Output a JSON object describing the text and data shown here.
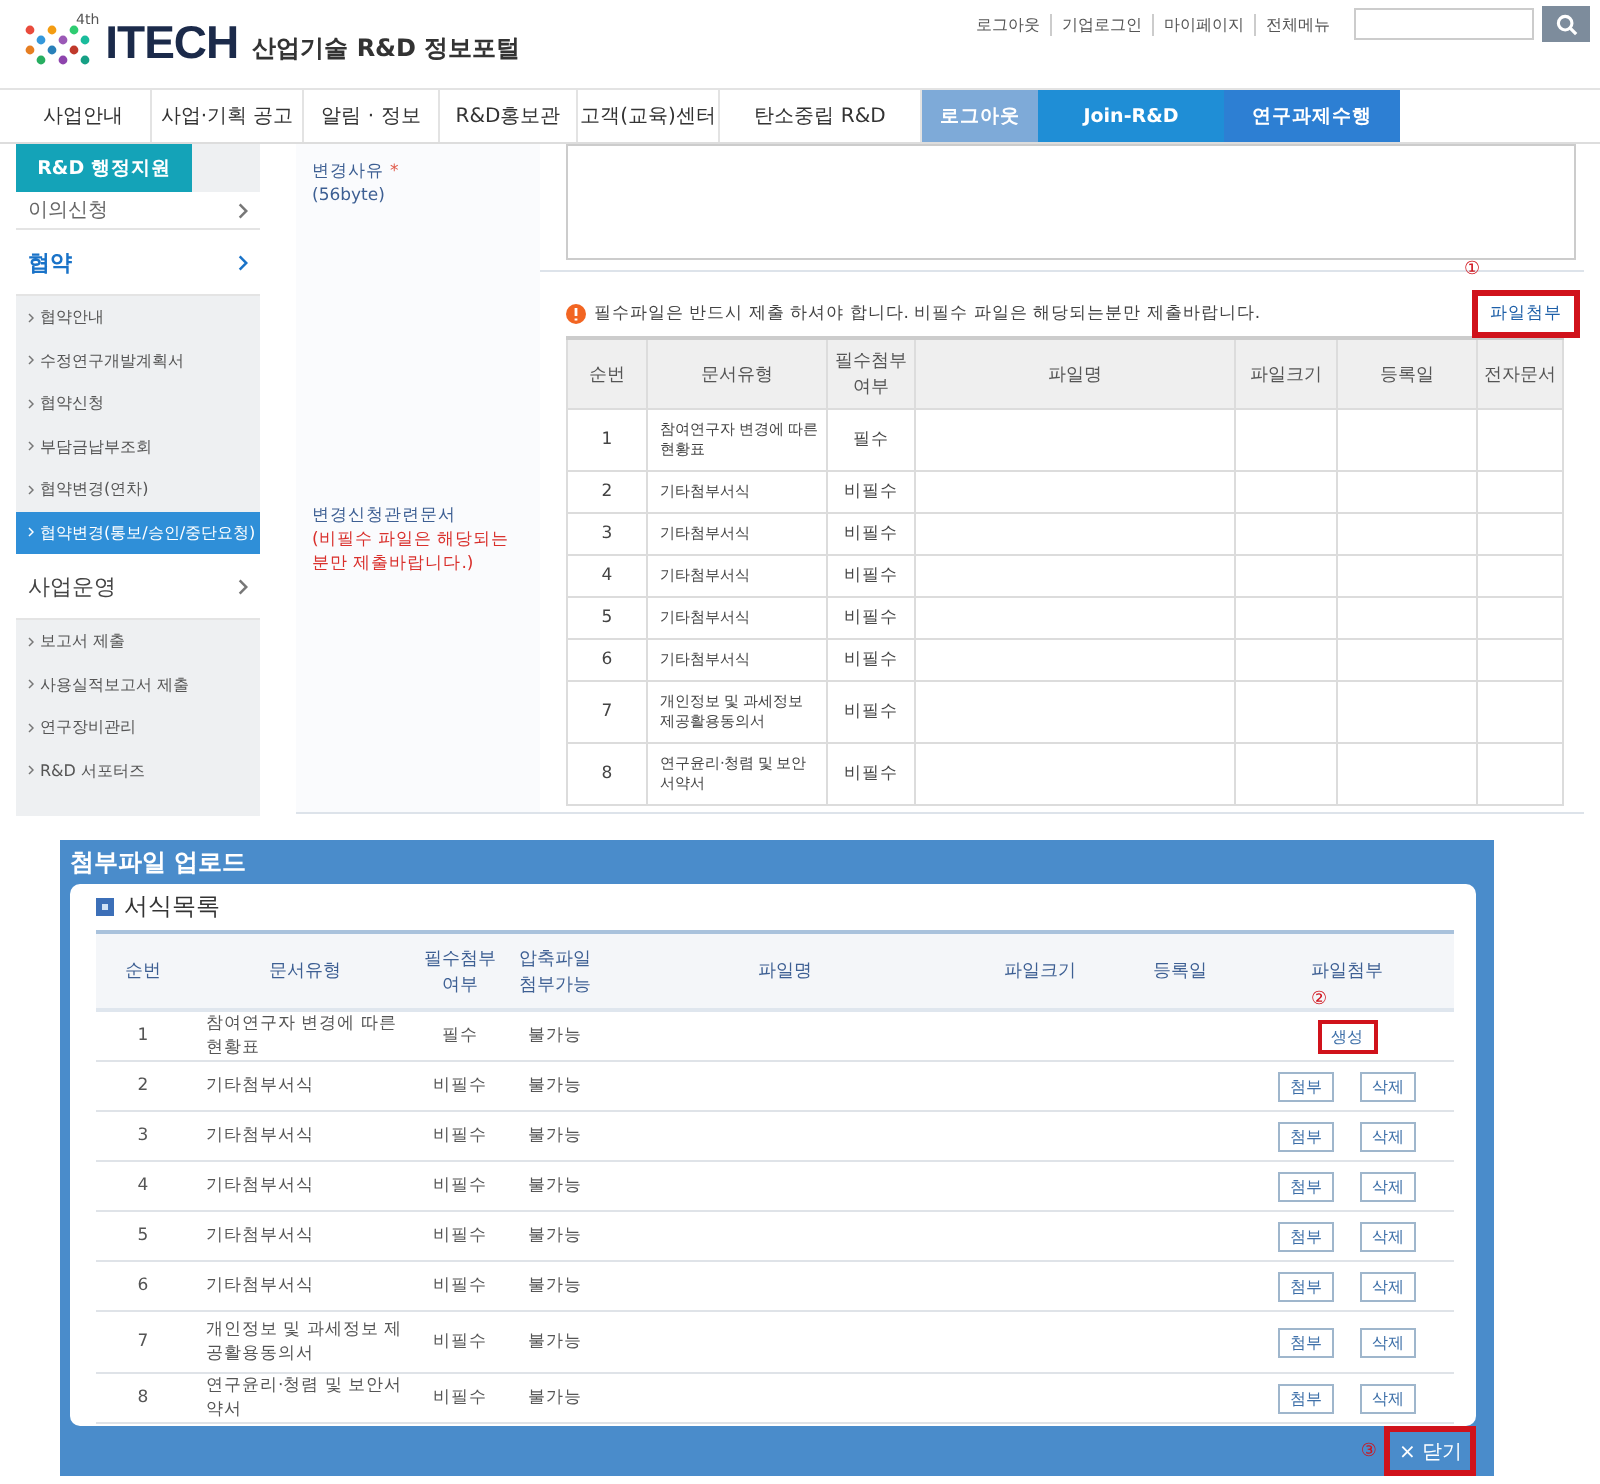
{
  "header": {
    "logo_badge": "4th",
    "logo_text": "ITECH",
    "logo_subtitle": "산업기술 R&D 정보포털",
    "links": [
      "로그아웃",
      "기업로그인",
      "마이페이지",
      "전체메뉴"
    ]
  },
  "nav": {
    "items": [
      "사업안내",
      "사업·기획 공고",
      "알림 · 정보",
      "R&D홍보관",
      "고객(교육)센터",
      "탄소중립 R&D"
    ],
    "actions": [
      {
        "label": "로그아웃",
        "kind": "light"
      },
      {
        "label": "Join-R&D",
        "kind": "mid"
      },
      {
        "label": "연구과제수행",
        "kind": "dark"
      }
    ]
  },
  "sidebar": {
    "badge": "R&D 행정지원",
    "items": [
      {
        "label": "이의신청",
        "selected": false
      },
      {
        "label": "협약",
        "selected": true,
        "children": [
          {
            "label": "협약안내",
            "selected": false
          },
          {
            "label": "수정연구개발계획서",
            "selected": false
          },
          {
            "label": "협약신청",
            "selected": false
          },
          {
            "label": "부담금납부조회",
            "selected": false
          },
          {
            "label": "협약변경(연차)",
            "selected": false
          },
          {
            "label": "협약변경(통보/승인/중단요청)",
            "selected": true
          }
        ]
      },
      {
        "label": "사업운영",
        "selected": false,
        "children": [
          {
            "label": "보고서 제출",
            "selected": false
          },
          {
            "label": "사용실적보고서 제출",
            "selected": false
          },
          {
            "label": "연구장비관리",
            "selected": false
          },
          {
            "label": "R&D 서포터즈",
            "selected": false
          }
        ]
      }
    ]
  },
  "form": {
    "reason": {
      "label": "변경사유",
      "required_mark": "*",
      "hint": "(56byte)"
    },
    "documents": {
      "label": "변경신청관련문서",
      "caution": "(비필수 파일은 해당되는분만 제출바랍니다.)",
      "notice": "필수파일은 반드시 제출 하셔야 합니다. 비필수 파일은 해당되는분만 제출바랍니다.",
      "marker": "①",
      "attach_button": {
        "label": "파일첨부",
        "highlighted": true
      },
      "table": {
        "columns": [
          "순번",
          "문서유형",
          "필수첨부\n여부",
          "파일명",
          "파일크기",
          "등록일",
          "전자문서"
        ],
        "rows": [
          {
            "no": "1",
            "type": "참여연구자 변경에 따른 현황표",
            "required": "필수"
          },
          {
            "no": "2",
            "type": "기타첨부서식",
            "required": "비필수"
          },
          {
            "no": "3",
            "type": "기타첨부서식",
            "required": "비필수"
          },
          {
            "no": "4",
            "type": "기타첨부서식",
            "required": "비필수"
          },
          {
            "no": "5",
            "type": "기타첨부서식",
            "required": "비필수"
          },
          {
            "no": "6",
            "type": "기타첨부서식",
            "required": "비필수"
          },
          {
            "no": "7",
            "type": "개인정보 및 과세정보 제공활용동의서",
            "required": "비필수"
          },
          {
            "no": "8",
            "type": "연구윤리·청렴 및 보안서약서",
            "required": "비필수"
          }
        ]
      }
    }
  },
  "popup": {
    "title": "첨부파일 업로드",
    "section_title": "서식목록",
    "table": {
      "columns": [
        "순번",
        "문서유형",
        "필수첨부\n여부",
        "압축파일\n첨부가능",
        "파일명",
        "파일크기",
        "등록일",
        "파일첨부"
      ],
      "rows": [
        {
          "no": "1",
          "type": "참여연구자 변경에 따른 현황표",
          "required": "필수",
          "compressed": "불가능",
          "actions": [
            {
              "label": "생성",
              "highlighted": true,
              "marker": "②"
            }
          ]
        },
        {
          "no": "2",
          "type": "기타첨부서식",
          "required": "비필수",
          "compressed": "불가능",
          "actions": [
            {
              "label": "첨부",
              "highlighted": false
            },
            {
              "label": "삭제",
              "highlighted": false
            }
          ]
        },
        {
          "no": "3",
          "type": "기타첨부서식",
          "required": "비필수",
          "compressed": "불가능",
          "actions": [
            {
              "label": "첨부",
              "highlighted": false
            },
            {
              "label": "삭제",
              "highlighted": false
            }
          ]
        },
        {
          "no": "4",
          "type": "기타첨부서식",
          "required": "비필수",
          "compressed": "불가능",
          "actions": [
            {
              "label": "첨부",
              "highlighted": false
            },
            {
              "label": "삭제",
              "highlighted": false
            }
          ]
        },
        {
          "no": "5",
          "type": "기타첨부서식",
          "required": "비필수",
          "compressed": "불가능",
          "actions": [
            {
              "label": "첨부",
              "highlighted": false
            },
            {
              "label": "삭제",
              "highlighted": false
            }
          ]
        },
        {
          "no": "6",
          "type": "기타첨부서식",
          "required": "비필수",
          "compressed": "불가능",
          "actions": [
            {
              "label": "첨부",
              "highlighted": false
            },
            {
              "label": "삭제",
              "highlighted": false
            }
          ]
        },
        {
          "no": "7",
          "type": "개인정보 및 과세정보 제공활용동의서",
          "required": "비필수",
          "compressed": "불가능",
          "actions": [
            {
              "label": "첨부",
              "highlighted": false
            },
            {
              "label": "삭제",
              "highlighted": false
            }
          ]
        },
        {
          "no": "8",
          "type": "연구윤리·청렴 및 보안서약서",
          "required": "비필수",
          "compressed": "불가능",
          "actions": [
            {
              "label": "첨부",
              "highlighted": false
            },
            {
              "label": "삭제",
              "highlighted": false
            }
          ]
        }
      ]
    },
    "close": {
      "label": "× 닫기",
      "marker": "③",
      "highlighted": true
    }
  }
}
